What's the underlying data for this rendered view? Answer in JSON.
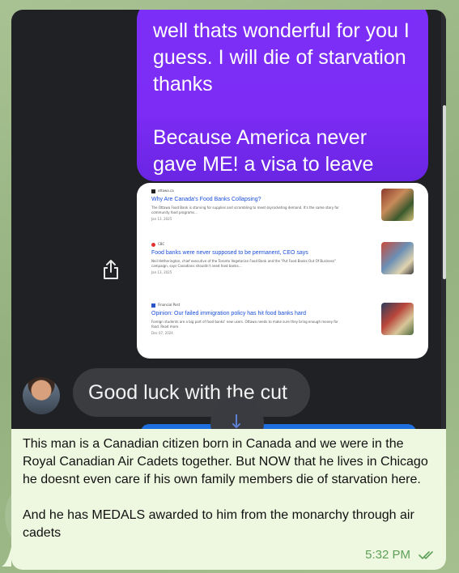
{
  "screenshot": {
    "sent_message": "well thats wonderful for you I guess. I will die of starvation thanks\n\nBecause America never gave ME! a visa to leave",
    "news_results": [
      {
        "source": "ottawa.ca",
        "title": "Why Are Canada's Food Banks Collapsing?",
        "snippet": "The Ottawa Food Bank is starving for supplies and scrambling to meet skyrocketing demand. It's the same story for community food programs...",
        "date": "Jan 13, 2025",
        "source_color": "#222222"
      },
      {
        "source": "CBC",
        "title": "Food banks were never supposed to be permanent, CEO says",
        "snippet": "Neil Hetherington, chief executive of the Toronto Vegetarian Food Bank and the \"Put Food Banks Out Of Business\" campaign, says Canadians shouldn't need food banks...",
        "date": "Jan 13, 2025",
        "source_color": "#e0322f"
      },
      {
        "source": "Financial Post",
        "title": "Opinion: Our failed immigration policy has hit food banks hard",
        "snippet": "Foreign students are a big part of food banks' new users. Ottawa needs to make sure they bring enough money for food. Read more.",
        "date": "Dec 07, 2024",
        "source_color": "#2b56c8"
      }
    ],
    "received_message": "Good luck with the cut",
    "share_icon": "share-icon",
    "scroll_down_icon": "arrow-down-icon"
  },
  "caption": "This man is a Canadian citizen born in Canada and we were in the Royal Canadian Air Cadets together. But NOW that he lives in Chicago he doesnt even care if his own family members die of starvation here.\n\nAnd he has MEDALS awarded to him from the monarchy through air cadets",
  "meta": {
    "time": "5:32 PM",
    "status_icon": "double-check-icon"
  },
  "colors": {
    "sent_bubble": "#7b2ff7",
    "link_title": "#1a4ed8",
    "time_green": "#5da05a",
    "bubble_bg": "#eef7df"
  }
}
